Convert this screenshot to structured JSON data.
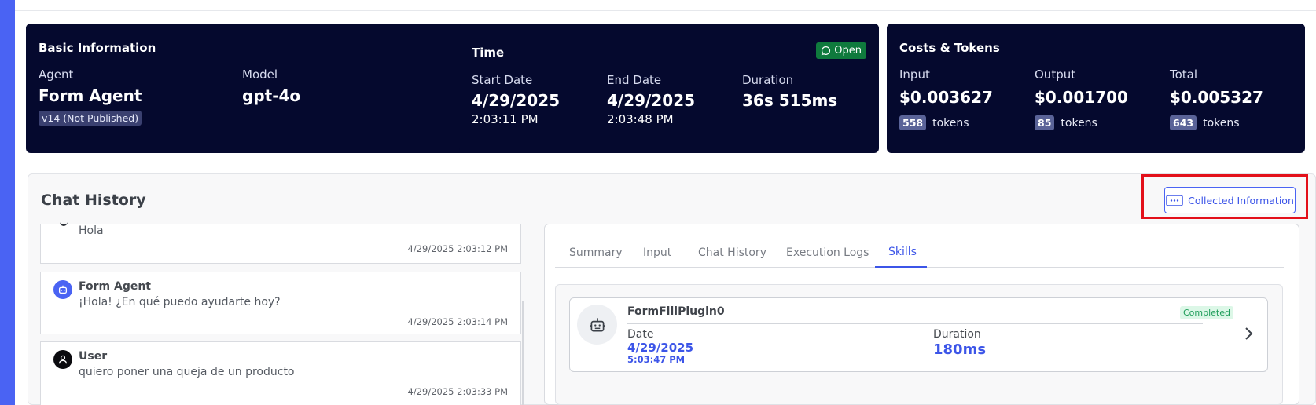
{
  "basic_info": {
    "title": "Basic Information",
    "agent_label": "Agent",
    "agent_value": "Form Agent",
    "version": "v14 (Not Published)",
    "model_label": "Model",
    "model_value": "gpt-4o"
  },
  "time": {
    "title": "Time",
    "status": "Open",
    "start_label": "Start Date",
    "start_date": "4/29/2025",
    "start_time": "2:03:11 PM",
    "end_label": "End Date",
    "end_date": "4/29/2025",
    "end_time": "2:03:48 PM",
    "duration_label": "Duration",
    "duration_value": "36s 515ms"
  },
  "costs": {
    "title": "Costs & Tokens",
    "input_label": "Input",
    "input_value": "$0.003627",
    "input_tokens": "558",
    "output_label": "Output",
    "output_value": "$0.001700",
    "output_tokens": "85",
    "total_label": "Total",
    "total_value": "$0.005327",
    "total_tokens": "643",
    "tokens_word": "tokens"
  },
  "chat": {
    "title": "Chat History",
    "collected_button": "Collected Information",
    "messages": [
      {
        "sender": "",
        "text": "Hola",
        "time": "4/29/2025 2:03:12 PM"
      },
      {
        "sender": "Form Agent",
        "text": "¡Hola! ¿En qué puedo ayudarte hoy?",
        "time": "4/29/2025 2:03:14 PM"
      },
      {
        "sender": "User",
        "text": "quiero poner una queja de un producto",
        "time": "4/29/2025 2:03:33 PM"
      }
    ]
  },
  "tabs": [
    "Summary",
    "Input",
    "Chat History",
    "Execution Logs",
    "Skills"
  ],
  "active_tab": "Skills",
  "skill": {
    "name": "FormFillPlugin0",
    "status": "Completed",
    "date_label": "Date",
    "date": "4/29/2025",
    "time": "5:03:47 PM",
    "duration_label": "Duration",
    "duration": "180ms"
  },
  "colors": {
    "accent": "#4a63f3",
    "card_bg": "#05092e",
    "link": "#3c55e8",
    "open_badge": "#0f7a3d",
    "highlight": "#e3101a"
  }
}
